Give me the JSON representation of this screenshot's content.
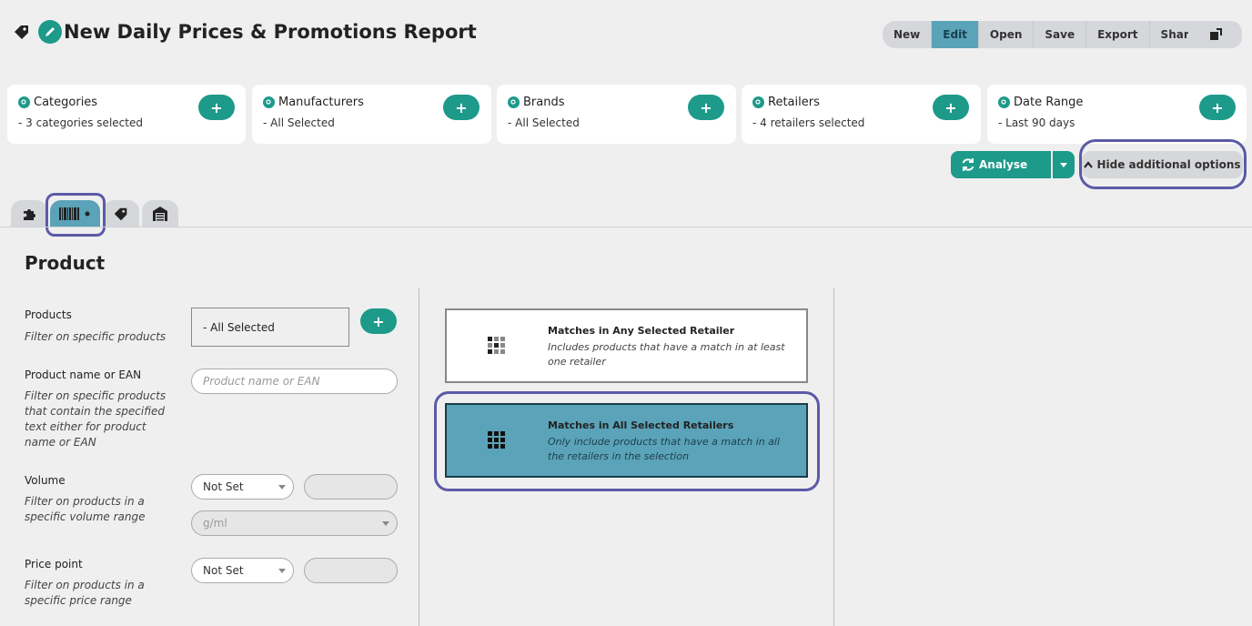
{
  "header": {
    "title": "New Daily Prices & Promotions Report",
    "icons": [
      "tag-icon",
      "edit-icon"
    ]
  },
  "toolbar": {
    "buttons": [
      "New",
      "Edit",
      "Open",
      "Save",
      "Export",
      "Share"
    ],
    "active": "Edit",
    "login_icon": "sign-in-icon"
  },
  "filters": [
    {
      "title": "Categories",
      "value": "- 3 categories selected"
    },
    {
      "title": "Manufacturers",
      "value": "- All Selected"
    },
    {
      "title": "Brands",
      "value": "- All Selected"
    },
    {
      "title": "Retailers",
      "value": "- 4 retailers selected"
    },
    {
      "title": "Date Range",
      "value": "- Last 90 days"
    }
  ],
  "actions": {
    "analyse_label": "Analyse",
    "hide_options_label": "Hide additional options"
  },
  "tabs": [
    {
      "icon": "puzzle-icon",
      "active": false
    },
    {
      "icon": "barcode-icon",
      "active": true
    },
    {
      "icon": "tag-icon",
      "active": false
    },
    {
      "icon": "store-icon",
      "active": false
    }
  ],
  "section": {
    "title": "Product"
  },
  "form": {
    "products": {
      "label": "Products",
      "desc": "Filter on specific products",
      "value": "- All Selected"
    },
    "name_ean": {
      "label": "Product name or EAN",
      "desc": "Filter on specific products that contain the specified text either for product name or EAN",
      "placeholder": "Product name or EAN"
    },
    "volume": {
      "label": "Volume",
      "desc": "Filter on products in a specific volume range",
      "select_value": "Not Set",
      "unit": "g/ml"
    },
    "price": {
      "label": "Price point",
      "desc": "Filter on products in a specific price range",
      "select_value": "Not Set"
    }
  },
  "match_options": [
    {
      "title": "Matches in Any Selected Retailer",
      "desc": "Includes products that have a match in at least one retailer",
      "selected": false
    },
    {
      "title": "Matches in All Selected Retailers",
      "desc": "Only include products that have a match in all the retailers in the selection",
      "selected": true
    }
  ],
  "colors": {
    "accent": "#1d9a8a",
    "active_tab": "#5aa3b9",
    "highlight_ring": "#5c5aa6"
  }
}
